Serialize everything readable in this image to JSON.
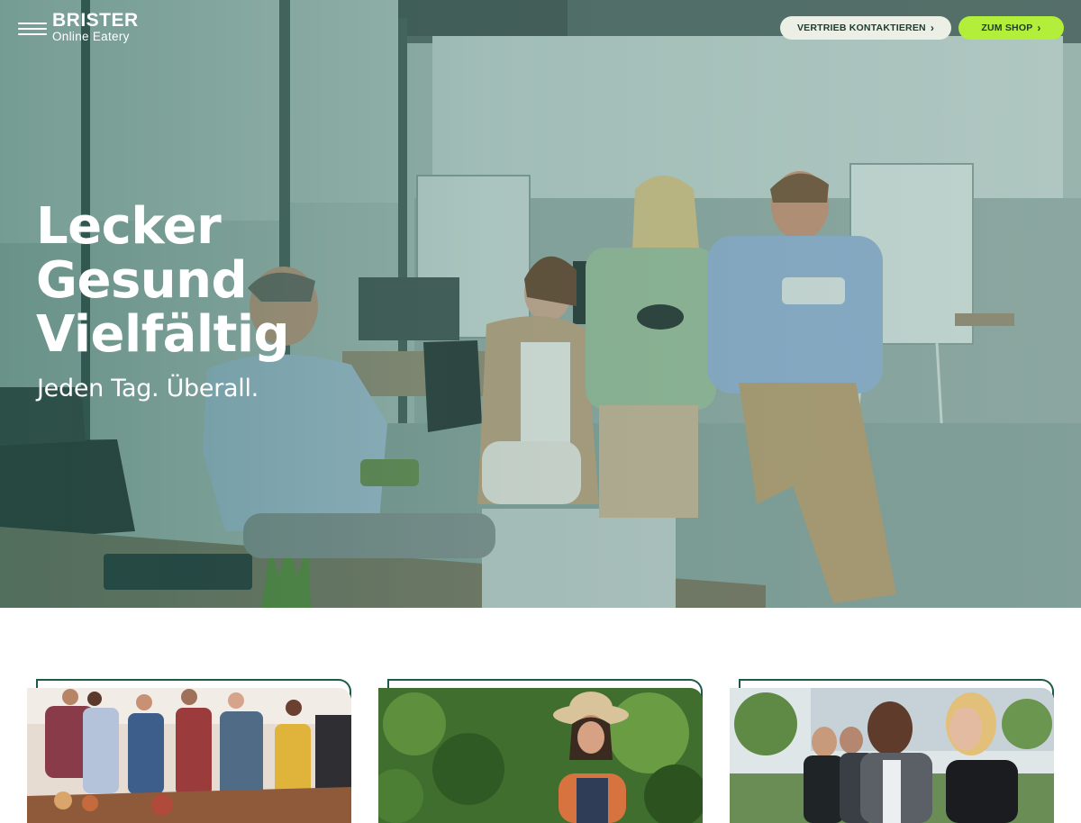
{
  "header": {
    "logo_main": "BRISTER",
    "logo_sub": "Online Eatery",
    "menu_icon": "hamburger-menu-icon",
    "buttons": {
      "sales_label": "VERTRIEB KONTAKTIEREN",
      "shop_label": "ZUM SHOP",
      "chevron": "›"
    }
  },
  "hero": {
    "headline": [
      "Lecker",
      "Gesund",
      "Vielfältig"
    ],
    "tagline": "Jeden Tag. Überall."
  },
  "colors": {
    "accent_lime": "#b3ee3a",
    "brand_green": "#1a5c45",
    "light_button": "#ecefe6",
    "text_dark": "#1d3b2f"
  }
}
